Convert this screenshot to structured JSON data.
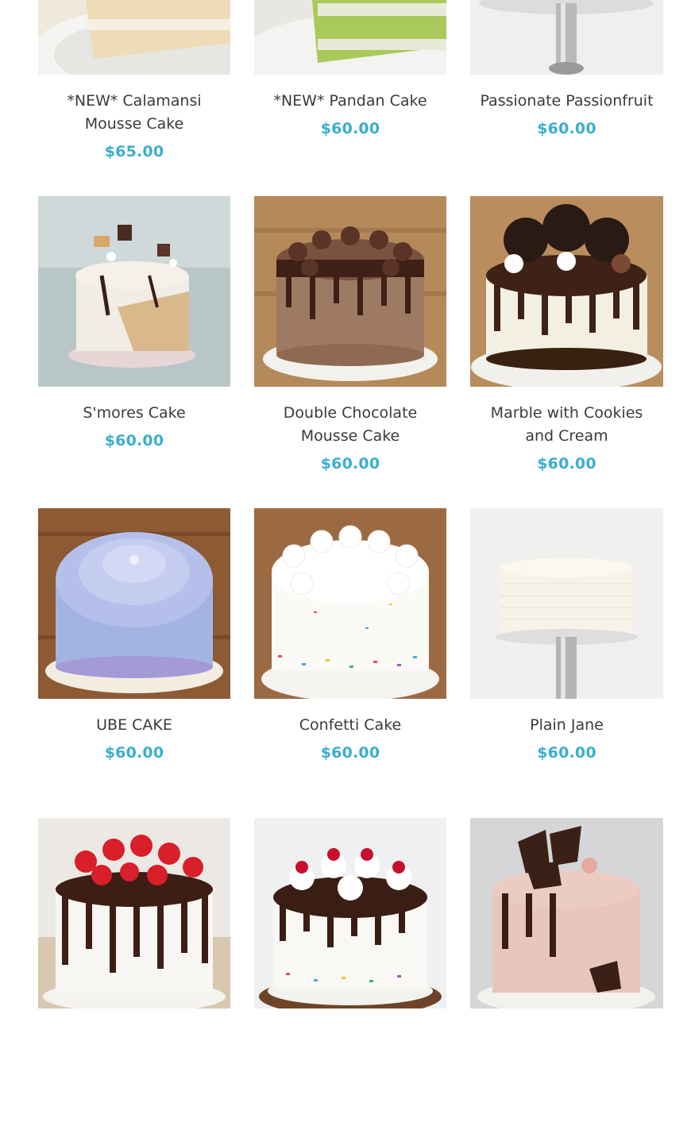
{
  "colors": {
    "price": "#3aaed0",
    "name": "#3a3a3a",
    "background": "#ffffff"
  },
  "products": [
    {
      "name": "*NEW* Calamansi Mousse Cake",
      "price": "$65.00",
      "image": "calamansi-cake-slice"
    },
    {
      "name": "*NEW* Pandan Cake",
      "price": "$60.00",
      "image": "pandan-cake-slice"
    },
    {
      "name": "Passionate Passionfruit",
      "price": "$60.00",
      "image": "passionfruit-cake-stand"
    },
    {
      "name": "S'mores Cake",
      "price": "$60.00",
      "image": "smores-cake"
    },
    {
      "name": "Double Chocolate Mousse Cake",
      "price": "$60.00",
      "image": "double-chocolate-cake"
    },
    {
      "name": "Marble with Cookies and Cream",
      "price": "$60.00",
      "image": "cookies-cream-cake"
    },
    {
      "name": "UBE CAKE",
      "price": "$60.00",
      "image": "ube-cake"
    },
    {
      "name": "Confetti Cake",
      "price": "$60.00",
      "image": "confetti-cake"
    },
    {
      "name": "Plain Jane",
      "price": "$60.00",
      "image": "plain-vanilla-cake"
    },
    {
      "name": "",
      "price": "",
      "image": "strawberry-chocolate-cake"
    },
    {
      "name": "",
      "price": "",
      "image": "cherry-funfetti-cake"
    },
    {
      "name": "",
      "price": "",
      "image": "chocolate-shard-pink-cake"
    }
  ]
}
